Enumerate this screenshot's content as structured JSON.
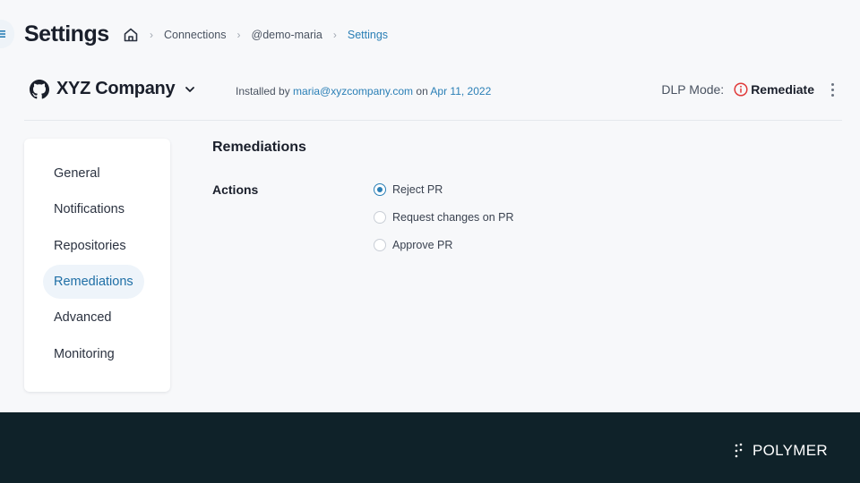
{
  "header": {
    "title": "Settings",
    "breadcrumbs": [
      "Connections",
      "@demo-maria",
      "Settings"
    ]
  },
  "company": {
    "name": "XYZ Company",
    "installed_prefix": "Installed by",
    "installed_by": "maria@xyzcompany.com",
    "installed_on_word": "on",
    "installed_date": "Apr 11, 2022",
    "dlp_label": "DLP Mode:",
    "dlp_value": "Remediate"
  },
  "sidebar": {
    "items": [
      {
        "label": "General"
      },
      {
        "label": "Notifications"
      },
      {
        "label": "Repositories"
      },
      {
        "label": "Remediations"
      },
      {
        "label": "Advanced"
      },
      {
        "label": "Monitoring"
      }
    ],
    "active": "Remediations"
  },
  "remediations": {
    "title": "Remediations",
    "actions_label": "Actions",
    "options": [
      {
        "label": "Reject PR",
        "selected": true
      },
      {
        "label": "Request changes on PR",
        "selected": false
      },
      {
        "label": "Approve PR",
        "selected": false
      }
    ]
  },
  "footer": {
    "brand": "POLYMER"
  },
  "colors": {
    "accent": "#2a7fb6",
    "warning": "#e03a3a",
    "footer_bg": "#0f2229"
  }
}
